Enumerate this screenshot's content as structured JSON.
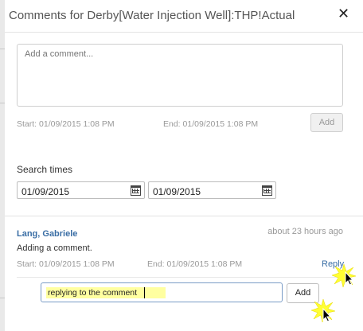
{
  "dialog": {
    "title": "Comments for Derby[Water Injection Well]:THP!Actual",
    "close_icon": "close-icon"
  },
  "new_comment": {
    "placeholder": "Add a comment...",
    "start_label": "Start: 01/09/2015 1:08 PM",
    "end_label": "End: 01/09/2015 1:08 PM",
    "add_label": "Add"
  },
  "search": {
    "label": "Search times",
    "from": "01/09/2015",
    "to": "01/09/2015",
    "calendar_icon": "calendar-icon"
  },
  "comments": [
    {
      "author": "Lang, Gabriele",
      "ago": "about 23 hours ago",
      "text": "Adding a comment.",
      "start": "Start: 01/09/2015 1:08 PM",
      "end": "End: 01/09/2015 1:08 PM",
      "reply_label": "Reply"
    }
  ],
  "reply": {
    "value": "replying to the comment",
    "add_label": "Add"
  },
  "colors": {
    "link": "#3a6ea5",
    "highlight": "#ffffa0",
    "click_burst": "#ffff00"
  }
}
